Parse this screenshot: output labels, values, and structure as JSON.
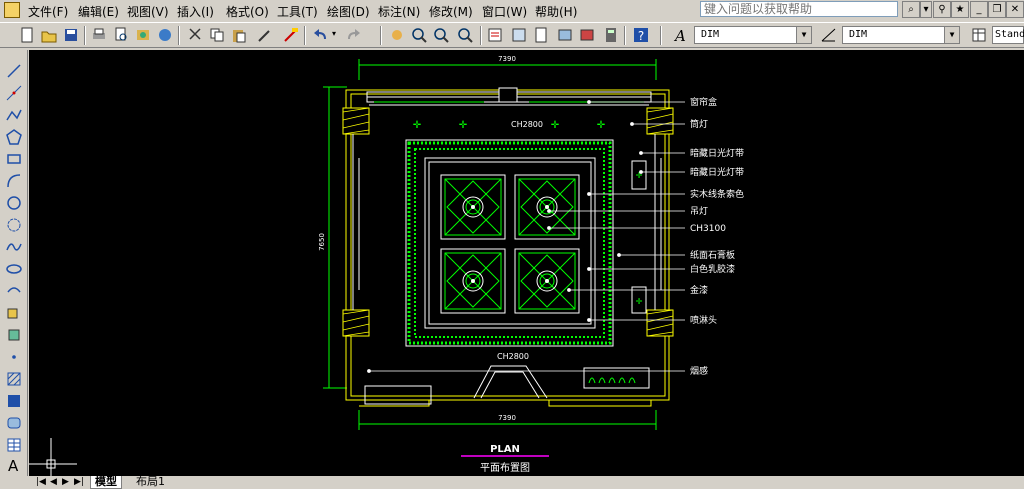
{
  "menu": {
    "items": [
      {
        "label": "文件(F)"
      },
      {
        "label": "编辑(E)"
      },
      {
        "label": "视图(V)"
      },
      {
        "label": "插入(I)"
      },
      {
        "label": "格式(O)"
      },
      {
        "label": "工具(T)"
      },
      {
        "label": "绘图(D)"
      },
      {
        "label": "标注(N)"
      },
      {
        "label": "修改(M)"
      },
      {
        "label": "窗口(W)"
      },
      {
        "label": "帮助(H)"
      }
    ],
    "help_placeholder": "键入问题以获取帮助"
  },
  "toolbar": {
    "text_style_value": "DIM",
    "dim_style_value": "DIM",
    "table_style_value": "Stand"
  },
  "drawing": {
    "dim_top": "7390",
    "dim_bottom": "7390",
    "dim_left": "7650",
    "ceiling_height_top": "CH2800",
    "ceiling_height_mid": "CH3100",
    "ceiling_height_bottom": "CH2800",
    "callouts": [
      {
        "text": "窗帘盒"
      },
      {
        "text": "筒灯"
      },
      {
        "text": "暗藏日光灯带"
      },
      {
        "text": "暗藏日光灯带"
      },
      {
        "text": "实木线条索色"
      },
      {
        "text": "吊灯"
      },
      {
        "text": "CH3100"
      },
      {
        "text": "纸面石膏板"
      },
      {
        "text": "白色乳胶漆"
      },
      {
        "text": "金漆"
      },
      {
        "text": "喷淋头"
      },
      {
        "text": "烟感"
      }
    ],
    "title": "PLAN",
    "subtitle": "平面布置图"
  },
  "tabs": {
    "model": "模型",
    "layout1": "布局1"
  },
  "colors": {
    "line_white": "#ffffff",
    "line_green": "#00ff00",
    "line_yellow": "#ffff00",
    "title_magenta": "#ff00ff",
    "canvas": "#000000"
  }
}
